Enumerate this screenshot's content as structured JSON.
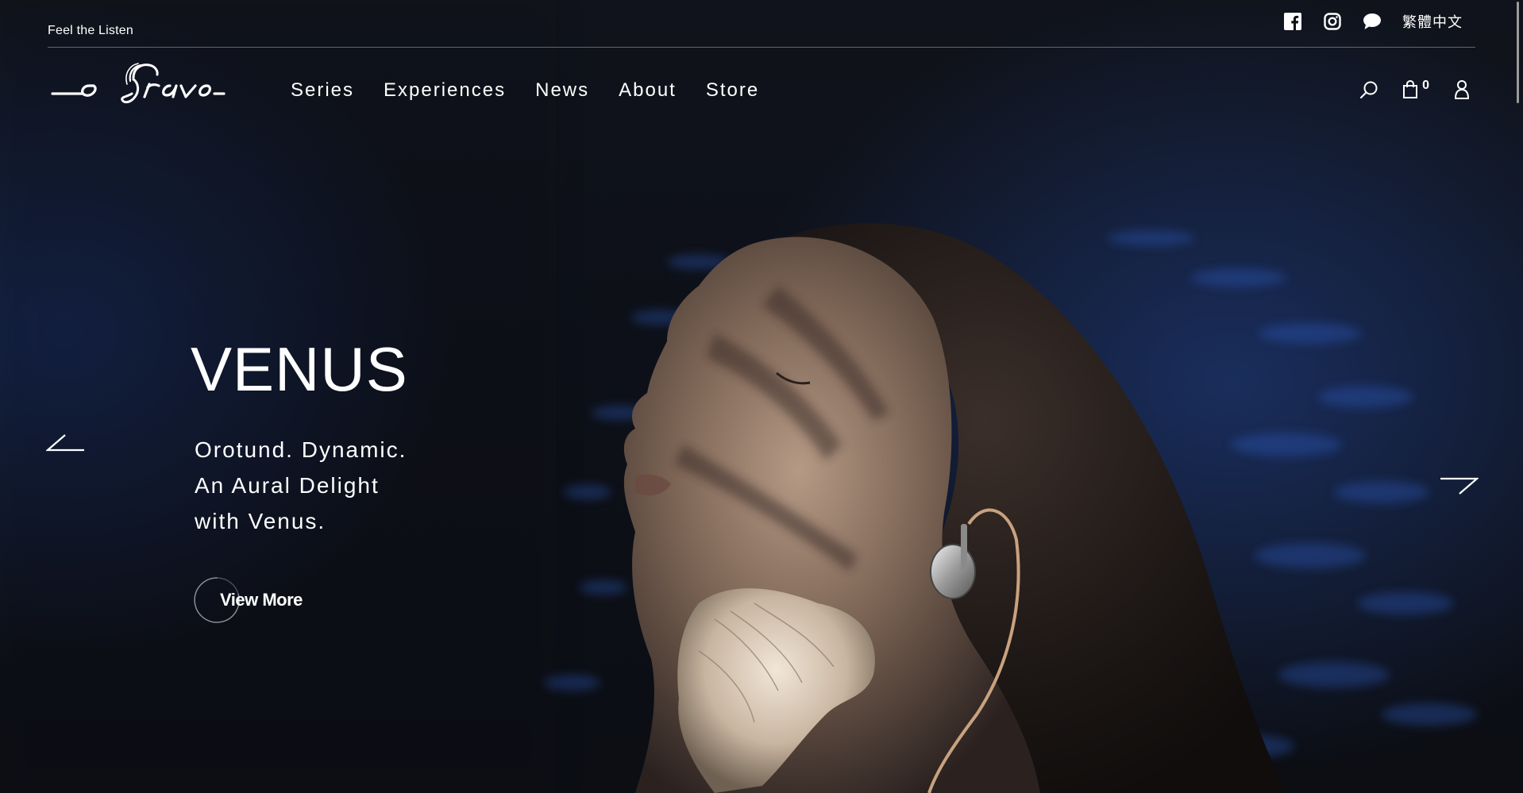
{
  "topbar": {
    "tagline": "Feel the Listen",
    "language_label": "繁體中文",
    "social_icons": [
      "facebook-icon",
      "instagram-icon",
      "chat-icon"
    ]
  },
  "header": {
    "logo_text": "Oriolus",
    "nav_items": [
      "Series",
      "Experiences",
      "News",
      "About",
      "Store"
    ],
    "icons": [
      "search-icon",
      "shopping-bag-icon",
      "user-icon"
    ],
    "cart_count": "0"
  },
  "hero": {
    "title": "VENUS",
    "subtitle_lines": [
      "Orotund. Dynamic.",
      "An Aural Delight",
      "with Venus."
    ],
    "cta_label": "View More",
    "image_description": "woman with closed eyes wearing in-ear monitor, holding coral",
    "colors": {
      "background": "#0d0e12",
      "accent_blue": "#2446a0",
      "text": "#ffffff"
    }
  }
}
